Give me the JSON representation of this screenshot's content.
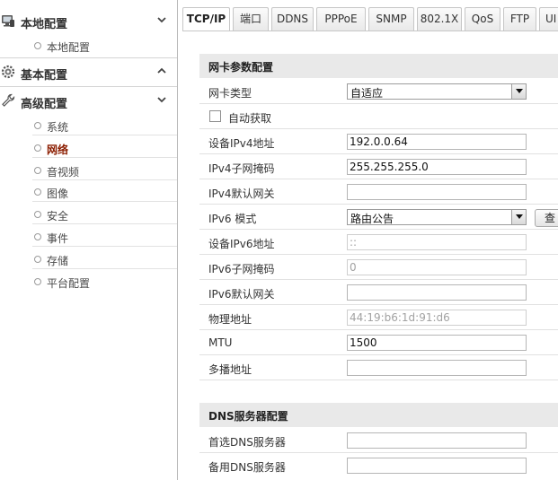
{
  "sidebar": {
    "sections": [
      {
        "label": "本地配置",
        "icon": "monitor-icon",
        "expanded": true,
        "items": [
          {
            "label": "本地配置"
          }
        ]
      },
      {
        "label": "基本配置",
        "icon": "gears-icon",
        "expanded": false,
        "items": []
      },
      {
        "label": "高级配置",
        "icon": "wrench-icon",
        "expanded": true,
        "items": [
          {
            "label": "系统"
          },
          {
            "label": "网络",
            "active": true
          },
          {
            "label": "音视频"
          },
          {
            "label": "图像"
          },
          {
            "label": "安全"
          },
          {
            "label": "事件"
          },
          {
            "label": "存储"
          },
          {
            "label": "平台配置"
          }
        ]
      }
    ]
  },
  "tabs": [
    "TCP/IP",
    "端口",
    "DDNS",
    "PPPoE",
    "SNMP",
    "802.1X",
    "QoS",
    "FTP",
    "UI"
  ],
  "active_tab": "TCP/IP",
  "nic_section": {
    "title": "网卡参数配置",
    "nic_type_label": "网卡类型",
    "nic_type_value": "自适应",
    "dhcp_label": "自动获取",
    "dhcp_checked": false,
    "ipv4_addr_label": "设备IPv4地址",
    "ipv4_addr_value": "192.0.0.64",
    "ipv4_mask_label": "IPv4子网掩码",
    "ipv4_mask_value": "255.255.255.0",
    "ipv4_gw_label": "IPv4默认网关",
    "ipv4_gw_value": "",
    "ipv6_mode_label": "IPv6 模式",
    "ipv6_mode_value": "路由公告",
    "ipv6_view_button": "查",
    "ipv6_addr_label": "设备IPv6地址",
    "ipv6_addr_value": "::",
    "ipv6_mask_label": "IPv6子网掩码",
    "ipv6_mask_value": "0",
    "ipv6_gw_label": "IPv6默认网关",
    "ipv6_gw_value": "",
    "mac_label": "物理地址",
    "mac_value": "44:19:b6:1d:91:d6",
    "mtu_label": "MTU",
    "mtu_value": "1500",
    "multicast_label": "多播地址",
    "multicast_value": ""
  },
  "dns_section": {
    "title": "DNS服务器配置",
    "preferred_label": "首选DNS服务器",
    "preferred_value": "",
    "alternate_label": "备用DNS服务器",
    "alternate_value": ""
  }
}
